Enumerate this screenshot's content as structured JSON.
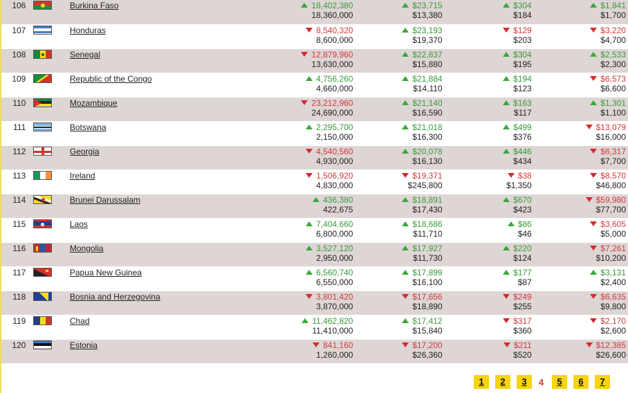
{
  "rows": [
    {
      "rank": "106",
      "country": "Burkina Faso",
      "flag_icon": "burkina-faso-flag-icon",
      "c1": {
        "dir": "up",
        "value": "18,402,380",
        "sub": "18,360,000"
      },
      "c2": {
        "dir": "up",
        "value": "$23,715",
        "sub": "$13,380"
      },
      "c3": {
        "dir": "up",
        "value": "$304",
        "sub": "$184"
      },
      "c4": {
        "dir": "up",
        "value": "$1,841",
        "sub": "$1,700"
      }
    },
    {
      "rank": "107",
      "country": "Honduras",
      "flag_icon": "honduras-flag-icon",
      "c1": {
        "dir": "down",
        "value": "8,540,320",
        "sub": "8,600,000"
      },
      "c2": {
        "dir": "up",
        "value": "$23,193",
        "sub": "$19,370"
      },
      "c3": {
        "dir": "down",
        "value": "$129",
        "sub": "$203"
      },
      "c4": {
        "dir": "down",
        "value": "$3,220",
        "sub": "$4,700"
      }
    },
    {
      "rank": "108",
      "country": "Senegal",
      "flag_icon": "senegal-flag-icon",
      "c1": {
        "dir": "down",
        "value": "12,879,960",
        "sub": "13,630,000"
      },
      "c2": {
        "dir": "up",
        "value": "$22,837",
        "sub": "$15,880"
      },
      "c3": {
        "dir": "up",
        "value": "$304",
        "sub": "$195"
      },
      "c4": {
        "dir": "up",
        "value": "$2,533",
        "sub": "$2,300"
      }
    },
    {
      "rank": "109",
      "country": "Republic of the Congo",
      "flag_icon": "congo-flag-icon",
      "c1": {
        "dir": "up",
        "value": "4,756,260",
        "sub": "4,660,000"
      },
      "c2": {
        "dir": "up",
        "value": "$21,884",
        "sub": "$14,110"
      },
      "c3": {
        "dir": "up",
        "value": "$194",
        "sub": "$123"
      },
      "c4": {
        "dir": "down",
        "value": "$6,573",
        "sub": "$6,600"
      }
    },
    {
      "rank": "110",
      "country": "Mozambique",
      "flag_icon": "mozambique-flag-icon",
      "c1": {
        "dir": "down",
        "value": "23,212,960",
        "sub": "24,690,000"
      },
      "c2": {
        "dir": "up",
        "value": "$21,140",
        "sub": "$16,590"
      },
      "c3": {
        "dir": "up",
        "value": "$163",
        "sub": "$117"
      },
      "c4": {
        "dir": "up",
        "value": "$1,301",
        "sub": "$1,100"
      }
    },
    {
      "rank": "111",
      "country": "Botswana",
      "flag_icon": "botswana-flag-icon",
      "c1": {
        "dir": "up",
        "value": "2,295,700",
        "sub": "2,150,000"
      },
      "c2": {
        "dir": "up",
        "value": "$21,018",
        "sub": "$16,300"
      },
      "c3": {
        "dir": "up",
        "value": "$499",
        "sub": "$376"
      },
      "c4": {
        "dir": "down",
        "value": "$13,079",
        "sub": "$16,000"
      }
    },
    {
      "rank": "112",
      "country": "Georgia",
      "flag_icon": "georgia-flag-icon",
      "c1": {
        "dir": "down",
        "value": "4,540,560",
        "sub": "4,930,000"
      },
      "c2": {
        "dir": "up",
        "value": "$20,078",
        "sub": "$16,130"
      },
      "c3": {
        "dir": "up",
        "value": "$446",
        "sub": "$434"
      },
      "c4": {
        "dir": "down",
        "value": "$6,317",
        "sub": "$7,700"
      }
    },
    {
      "rank": "113",
      "country": "Ireland",
      "flag_icon": "ireland-flag-icon",
      "c1": {
        "dir": "down",
        "value": "1,506,920",
        "sub": "4,830,000"
      },
      "c2": {
        "dir": "down",
        "value": "$19,371",
        "sub": "$245,800"
      },
      "c3": {
        "dir": "down",
        "value": "$38",
        "sub": "$1,350"
      },
      "c4": {
        "dir": "down",
        "value": "$8,570",
        "sub": "$46,800"
      }
    },
    {
      "rank": "114",
      "country": "Brunei Darussalam",
      "flag_icon": "brunei-flag-icon",
      "c1": {
        "dir": "up",
        "value": "436,380",
        "sub": "422,675"
      },
      "c2": {
        "dir": "up",
        "value": "$18,891",
        "sub": "$17,430"
      },
      "c3": {
        "dir": "up",
        "value": "$670",
        "sub": "$423"
      },
      "c4": {
        "dir": "down",
        "value": "$59,980",
        "sub": "$77,700"
      }
    },
    {
      "rank": "115",
      "country": "Laos",
      "flag_icon": "laos-flag-icon",
      "c1": {
        "dir": "up",
        "value": "7,404,660",
        "sub": "6,800,000"
      },
      "c2": {
        "dir": "up",
        "value": "$18,686",
        "sub": "$11,710"
      },
      "c3": {
        "dir": "up",
        "value": "$86",
        "sub": "$46"
      },
      "c4": {
        "dir": "down",
        "value": "$3,605",
        "sub": "$5,000"
      }
    },
    {
      "rank": "116",
      "country": "Mongolia",
      "flag_icon": "mongolia-flag-icon",
      "c1": {
        "dir": "up",
        "value": "3,527,120",
        "sub": "2,950,000"
      },
      "c2": {
        "dir": "up",
        "value": "$17,927",
        "sub": "$11,730"
      },
      "c3": {
        "dir": "up",
        "value": "$220",
        "sub": "$124"
      },
      "c4": {
        "dir": "down",
        "value": "$7,261",
        "sub": "$10,200"
      }
    },
    {
      "rank": "117",
      "country": "Papua New Guinea",
      "flag_icon": "papua-new-guinea-flag-icon",
      "c1": {
        "dir": "up",
        "value": "6,560,740",
        "sub": "6,550,000"
      },
      "c2": {
        "dir": "up",
        "value": "$17,899",
        "sub": "$16,100"
      },
      "c3": {
        "dir": "up",
        "value": "$177",
        "sub": "$87"
      },
      "c4": {
        "dir": "up",
        "value": "$3,131",
        "sub": "$2,400"
      }
    },
    {
      "rank": "118",
      "country": "Bosnia and Herzegovina",
      "flag_icon": "bosnia-flag-icon",
      "c1": {
        "dir": "down",
        "value": "3,801,420",
        "sub": "3,870,000"
      },
      "c2": {
        "dir": "down",
        "value": "$17,656",
        "sub": "$18,890"
      },
      "c3": {
        "dir": "down",
        "value": "$249",
        "sub": "$255"
      },
      "c4": {
        "dir": "down",
        "value": "$6,635",
        "sub": "$9,800"
      }
    },
    {
      "rank": "119",
      "country": "Chad",
      "flag_icon": "chad-flag-icon",
      "c1": {
        "dir": "up",
        "value": "11,462,820",
        "sub": "11,410,000"
      },
      "c2": {
        "dir": "up",
        "value": "$17,412",
        "sub": "$15,840"
      },
      "c3": {
        "dir": "down",
        "value": "$317",
        "sub": "$360"
      },
      "c4": {
        "dir": "down",
        "value": "$2,170",
        "sub": "$2,600"
      }
    },
    {
      "rank": "120",
      "country": "Estonia",
      "flag_icon": "estonia-flag-icon",
      "c1": {
        "dir": "down",
        "value": "841,160",
        "sub": "1,260,000"
      },
      "c2": {
        "dir": "down",
        "value": "$17,200",
        "sub": "$26,360"
      },
      "c3": {
        "dir": "down",
        "value": "$211",
        "sub": "$520"
      },
      "c4": {
        "dir": "down",
        "value": "$12,385",
        "sub": "$26,600"
      }
    }
  ],
  "pagination": {
    "pages": [
      "1",
      "2",
      "3",
      "4",
      "5",
      "6",
      "7"
    ],
    "current": "4"
  },
  "colors": {
    "row_alt": "#ded5d5",
    "up": "#3a9a3a",
    "down": "#d23a3a",
    "pager_bg": "#f8d412"
  }
}
